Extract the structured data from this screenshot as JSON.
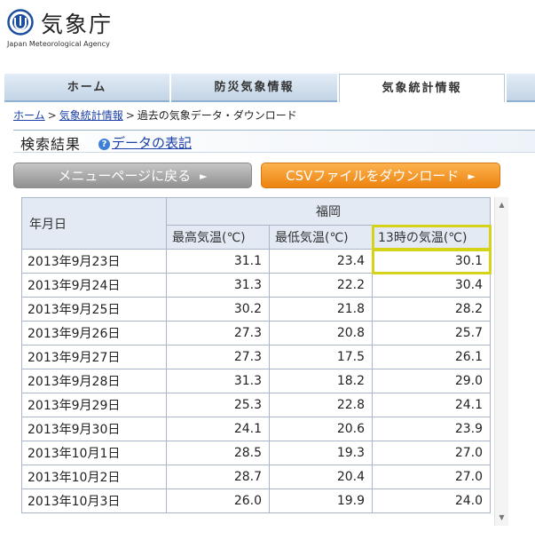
{
  "logo": {
    "name": "気象庁",
    "subtitle": "Japan Meteorological Agency"
  },
  "nav": {
    "tabs": [
      {
        "label": "ホーム",
        "active": false
      },
      {
        "label": "防災気象情報",
        "active": false
      },
      {
        "label": "気象統計情報",
        "active": true
      }
    ]
  },
  "breadcrumb": {
    "home": "ホーム",
    "stats": "気象統計情報",
    "current": "過去の気象データ・ダウンロード",
    "separator": ">"
  },
  "results": {
    "title": "検索結果",
    "help_link": "データの表記",
    "help_icon": "question-icon"
  },
  "buttons": {
    "back": "メニューページに戻る",
    "csv": "CSVファイルをダウンロード",
    "arrow": "►"
  },
  "table": {
    "date_header": "年月日",
    "region": "福岡",
    "columns": [
      "最高気温(℃)",
      "最低気温(℃)",
      "13時の気温(℃)"
    ],
    "highlighted_column": 2,
    "rows": [
      {
        "date": "2013年9月23日",
        "max": "31.1",
        "min": "23.4",
        "t13": "30.1"
      },
      {
        "date": "2013年9月24日",
        "max": "31.3",
        "min": "22.2",
        "t13": "30.4"
      },
      {
        "date": "2013年9月25日",
        "max": "30.2",
        "min": "21.8",
        "t13": "28.2"
      },
      {
        "date": "2013年9月26日",
        "max": "27.3",
        "min": "20.8",
        "t13": "25.7"
      },
      {
        "date": "2013年9月27日",
        "max": "27.3",
        "min": "17.5",
        "t13": "26.1"
      },
      {
        "date": "2013年9月28日",
        "max": "31.3",
        "min": "18.2",
        "t13": "29.0"
      },
      {
        "date": "2013年9月29日",
        "max": "25.3",
        "min": "22.8",
        "t13": "24.1"
      },
      {
        "date": "2013年9月30日",
        "max": "24.1",
        "min": "20.6",
        "t13": "23.9"
      },
      {
        "date": "2013年10月1日",
        "max": "28.5",
        "min": "19.3",
        "t13": "27.0"
      },
      {
        "date": "2013年10月2日",
        "max": "28.7",
        "min": "20.4",
        "t13": "27.0"
      },
      {
        "date": "2013年10月3日",
        "max": "26.0",
        "min": "19.9",
        "t13": "24.0"
      }
    ]
  },
  "colors": {
    "nav_gradient_top": "#e2ecf6",
    "link": "#1a3fa8",
    "csv_button": "#f29322",
    "back_button": "#a6a6a6",
    "header_bg": "#e3eaf4",
    "highlight": "#d6d21a"
  }
}
